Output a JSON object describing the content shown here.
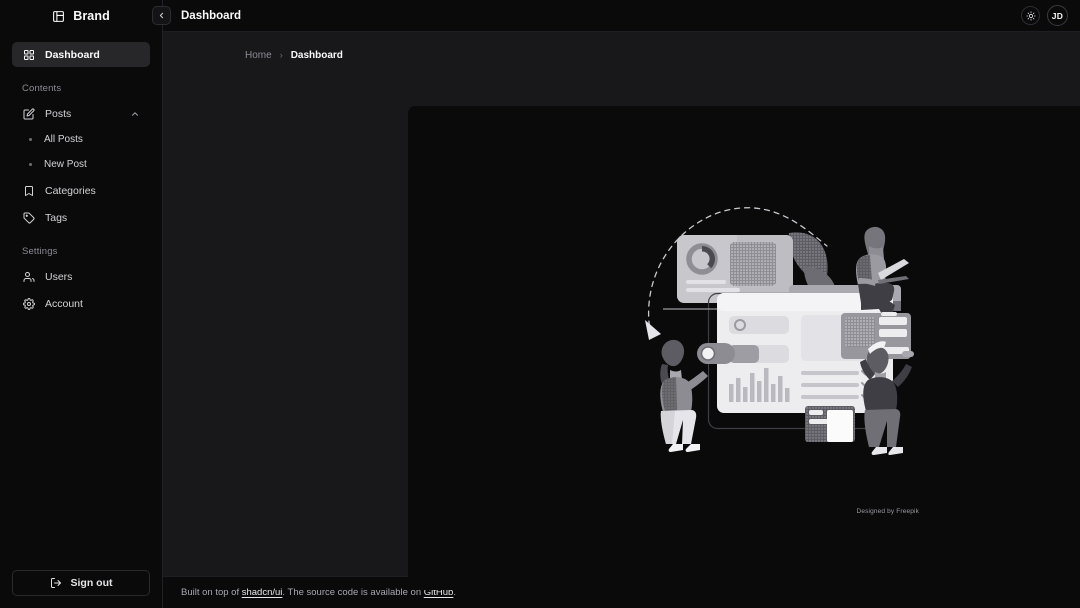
{
  "brand": {
    "name": "Brand",
    "icon": "panel-layout-icon"
  },
  "sidebar": {
    "primary": [
      {
        "label": "Dashboard",
        "icon": "grid-icon",
        "active": true
      }
    ],
    "groups": [
      {
        "label": "Contents",
        "items": [
          {
            "label": "Posts",
            "icon": "edit-square-icon",
            "expanded": true,
            "chevron": "chevron-up-icon"
          },
          {
            "label": "Categories",
            "icon": "bookmark-icon"
          },
          {
            "label": "Tags",
            "icon": "tag-icon"
          }
        ],
        "subitems": [
          {
            "label": "All Posts"
          },
          {
            "label": "New Post"
          }
        ]
      },
      {
        "label": "Settings",
        "items": [
          {
            "label": "Users",
            "icon": "users-icon"
          },
          {
            "label": "Account",
            "icon": "gear-icon"
          }
        ]
      }
    ],
    "sign_out": {
      "label": "Sign out",
      "icon": "logout-icon"
    },
    "collapse_button": {
      "icon": "chevron-left-icon"
    }
  },
  "topbar": {
    "title": "Dashboard",
    "theme_toggle": {
      "icon": "sun-icon"
    },
    "avatar": {
      "initials": "JD"
    }
  },
  "breadcrumb": {
    "home": "Home",
    "separator": "›",
    "current": "Dashboard"
  },
  "main": {
    "illustration_credit": "Designed by Freepik"
  },
  "footer": {
    "prefix": "Built on top of ",
    "link1": "shadcn/ui",
    "middle": ". The source code is available on ",
    "link2": "GitHub",
    "suffix": "."
  },
  "colors": {
    "page_bg": "#18181b",
    "panel_bg": "#0a0a0b",
    "active_bg": "#27272a",
    "text": "#fafafa",
    "muted": "#8b8b93"
  }
}
